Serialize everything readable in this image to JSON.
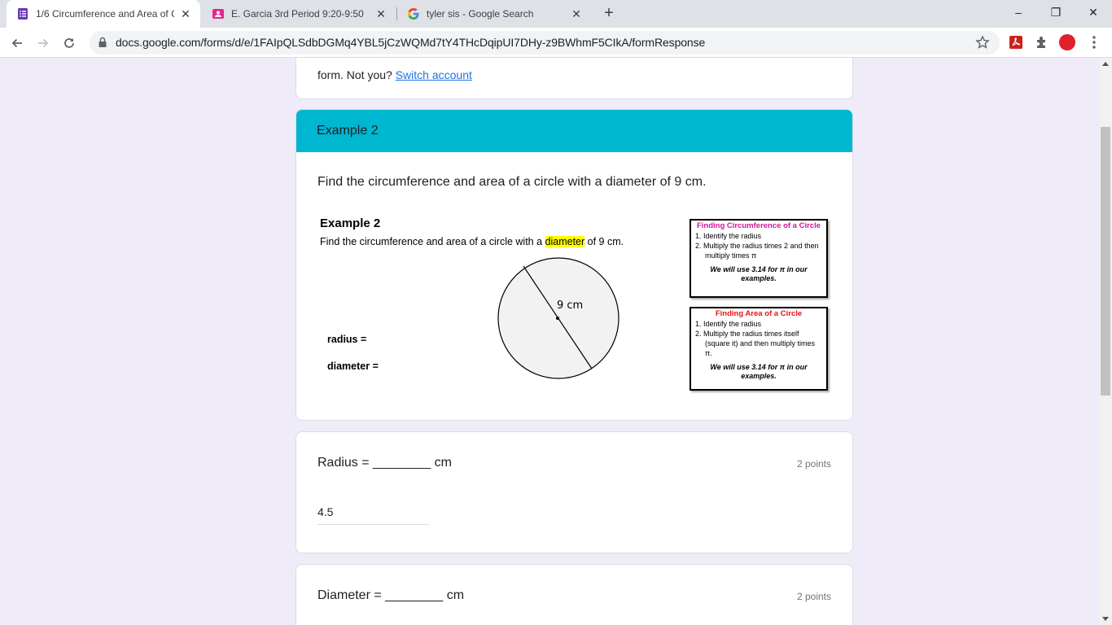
{
  "browser": {
    "tabs": [
      {
        "title": "1/6 Circumference and Area of C",
        "icon": "google-forms-icon",
        "color": "#673ab7"
      },
      {
        "title": "E. Garcia 3rd Period 9:20-9:50",
        "icon": "contacts-icon",
        "color": "#e52592"
      },
      {
        "title": "tyler sis - Google Search",
        "icon": "google-icon",
        "color": "#4285f4"
      }
    ],
    "url": "docs.google.com/forms/d/e/1FAIpQLSdbDGMq4YBL5jCzWQMd7tY4THcDqipUI7DHy-z9BWhmF5CIkA/formResponse",
    "new_tab_glyph": "+",
    "window_buttons": {
      "minimize": "–",
      "maximize": "❐",
      "close": "✕"
    }
  },
  "form": {
    "account_line_prefix": "form. Not you?",
    "switch_account": "Switch account",
    "section_title": "Example 2",
    "section_prompt": "Find the circumference and area of a circle with a diameter of 9 cm.",
    "figure": {
      "title": "Example 2",
      "text_before": "Find the circumference and area of a circle with a",
      "highlight": "diameter",
      "text_after": "of 9 cm.",
      "circle_label": "9 cm",
      "radius_label": "radius =",
      "diameter_label": "diameter =",
      "box1": {
        "title": "Finding Circumference of a Circle",
        "step1": "1.  Identify the radius",
        "step2": "2.  Multiply the radius times 2 and then multiply times π",
        "note": "We will use 3.14 for π in our examples.",
        "title_color": "#d4149a"
      },
      "box2": {
        "title": "Finding Area of a Circle",
        "step1": "1. Identify the radius",
        "step2": "2. Multiply the radius times itself (square it) and then multiply times π.",
        "note": "We will use 3.14 for π in our examples.",
        "title_color": "#e8101a"
      }
    },
    "questions": [
      {
        "text": "Radius = ________ cm",
        "points": "2 points",
        "answer": "4.5"
      },
      {
        "text": "Diameter = ________ cm",
        "points": "2 points"
      }
    ],
    "accent_color": "#00b7d2"
  }
}
